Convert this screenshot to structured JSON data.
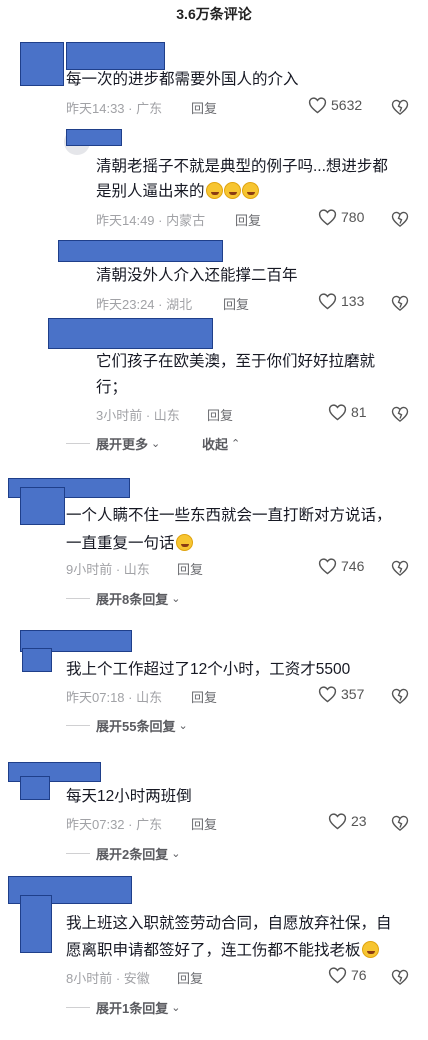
{
  "header": {
    "title": "3.6万条评论"
  },
  "comments": [
    {
      "text": "每一次的进步都需要外国人的介入",
      "time": "昨天14:33 · 广东",
      "reply": "回复",
      "likes": "5632"
    },
    {
      "text1": "清朝老摇子不就是典型的例子吗...想进步都",
      "text2": "是别人逼出来的",
      "time": "昨天14:49 · 内蒙古",
      "reply": "回复",
      "likes": "780"
    },
    {
      "text": "清朝没外人介入还能撑二百年",
      "time": "昨天23:24 · 湖北",
      "reply": "回复",
      "likes": "133"
    },
    {
      "text1": "它们孩子在欧美澳，至于你们好好拉磨就",
      "text2": "行；",
      "time": "3小时前 · 山东",
      "reply": "回复",
      "likes": "81",
      "expand": "展开更多",
      "collapse": "收起"
    },
    {
      "text1": "一个人瞒不住一些东西就会一直打断对方说话，",
      "text2": "一直重复一句话",
      "time": "9小时前 · 山东",
      "reply": "回复",
      "likes": "746",
      "expand": "展开8条回复"
    },
    {
      "text": "我上个工作超过了12个小时，工资才5500",
      "time": "昨天07:18 · 山东",
      "reply": "回复",
      "likes": "357",
      "expand": "展开55条回复"
    },
    {
      "text": "每天12小时两班倒",
      "time": "昨天07:32 · 广东",
      "reply": "回复",
      "likes": "23",
      "expand": "展开2条回复"
    },
    {
      "text1": "我上班这入职就签劳动合同，自愿放弃社保，自",
      "text2": "愿离职申请都签好了，连工伤都不能找老板",
      "time": "8小时前 · 安徽",
      "reply": "回复",
      "likes": "76",
      "expand": "展开1条回复"
    }
  ],
  "icons": {
    "like": "heart-outline-icon",
    "dislike": "broken-heart-icon",
    "chevron": "chevron-down-icon",
    "emoji": "laughing-emoji-icon"
  },
  "colors": {
    "redaction": "#4a72c8",
    "meta": "#a1a2a6",
    "text": "#161823"
  }
}
